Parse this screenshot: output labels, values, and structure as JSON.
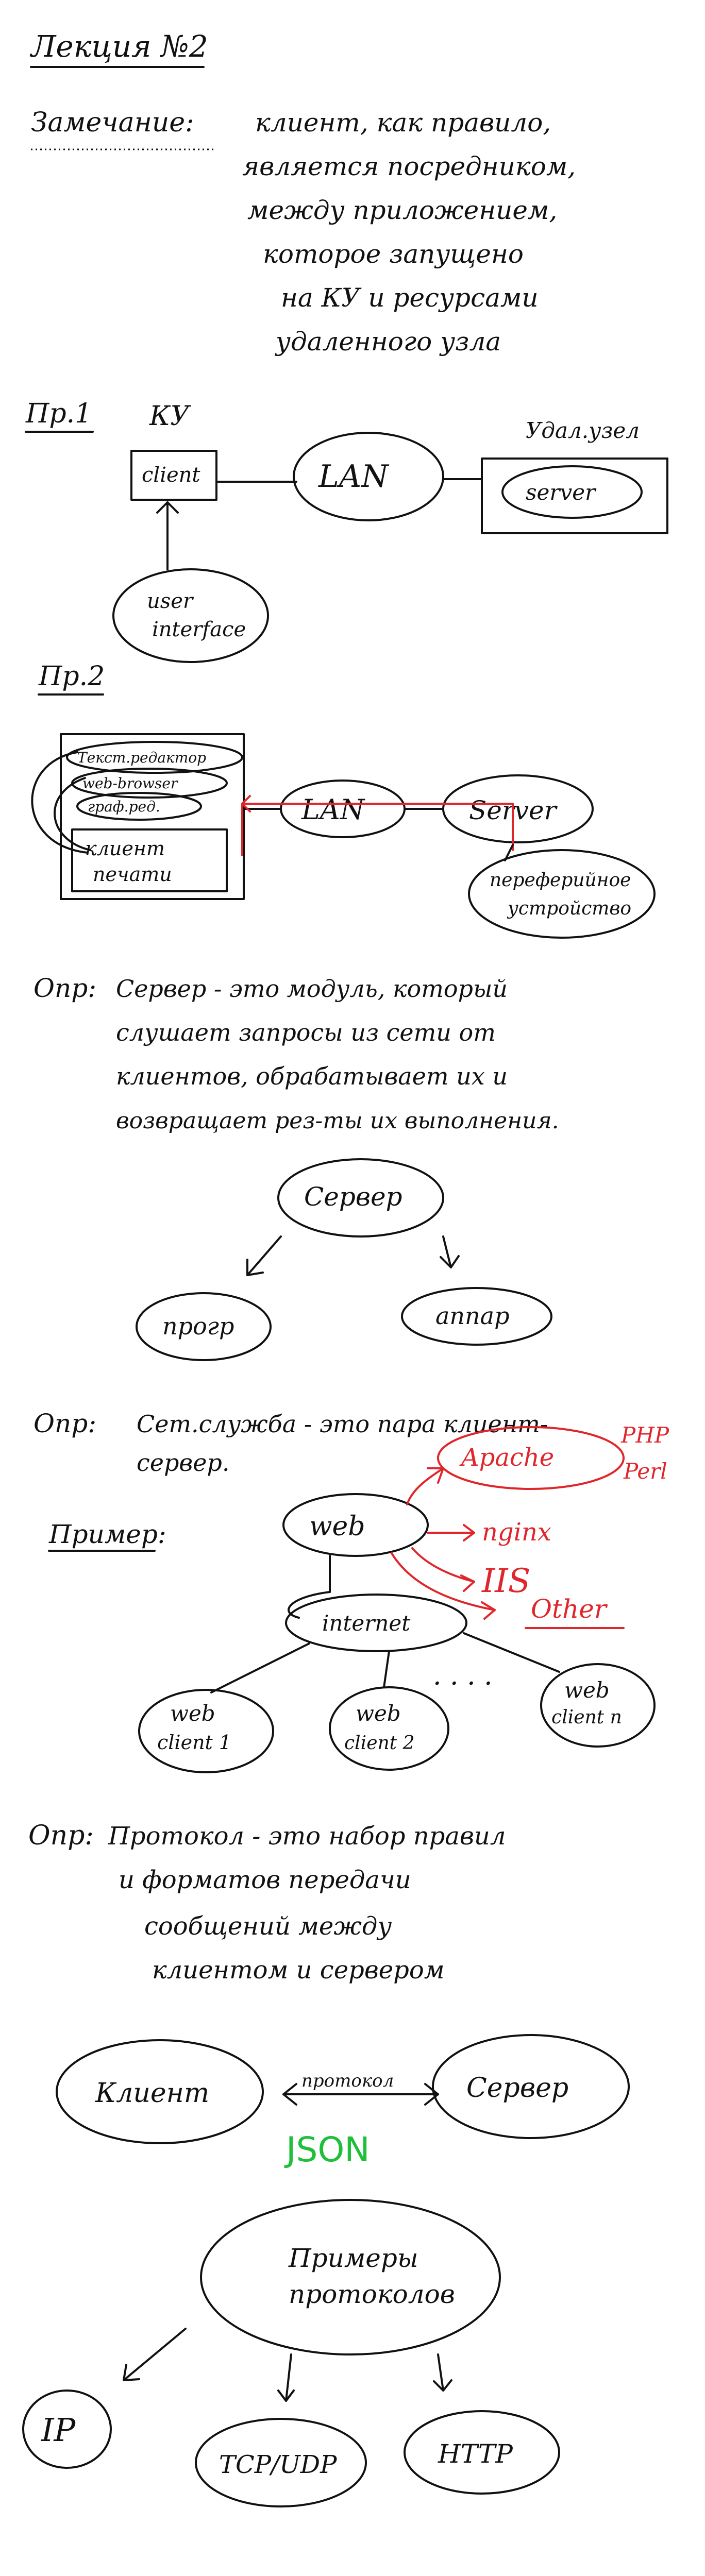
{
  "lecture": {
    "title": "Лекция №2"
  },
  "note": {
    "label": "Замечание:",
    "lines": [
      "клиент, как правило,",
      "является посредником,",
      "между приложением,",
      "которое запущено",
      "на КУ и ресурсами",
      "удаленного узла"
    ]
  },
  "example1": {
    "label": "Пр.1",
    "ku": "КУ",
    "client": "client",
    "lan": "LAN",
    "remote": "Удал.узел",
    "server": "server",
    "ui": [
      "user",
      "interface"
    ]
  },
  "example2": {
    "label": "Пр.2",
    "apps": [
      "Текст.редактор",
      "web-browser",
      "граф.ред."
    ],
    "print_client": [
      "клиент",
      "печати"
    ],
    "lan": "LAN",
    "server": "Server",
    "output": [
      "переферийное",
      "устройство"
    ]
  },
  "def_server": {
    "label": "Опр:",
    "lines": [
      "Сервер - это модуль, который",
      "слушает запросы из сети от",
      "клиентов, обрабатывает их и",
      "возвращает рез-ты их выполнения."
    ],
    "node": "Сервер",
    "left": "прогр",
    "right": "аппар"
  },
  "def_service": {
    "label": "Опр:",
    "lines": [
      "Сет.служба - это пара клиент-",
      "сервер."
    ],
    "example_label": "Пример:",
    "web": "web",
    "apache": "Apache",
    "php": "PHP",
    "perl": "Perl",
    "nginx": "nginx",
    "iis": "IIS",
    "other": "Other",
    "internet": "internet",
    "clients": [
      [
        "web",
        "client 1"
      ],
      [
        "web",
        "client 2"
      ],
      [
        "web",
        "client n"
      ]
    ],
    "ellipsis": ". . . ."
  },
  "def_protocol": {
    "label": "Опр:",
    "lines": [
      "Протокол - это набор правил",
      "и форматов передачи",
      "сообщений между",
      "клиентом и сервером"
    ],
    "client": "Клиент",
    "protocol": "протокол",
    "server": "Сервер",
    "format": "JSON",
    "examples_title": [
      "Примеры",
      "протоколов"
    ],
    "examples": [
      "IP",
      "TCP/UDP",
      "HTTP"
    ]
  }
}
